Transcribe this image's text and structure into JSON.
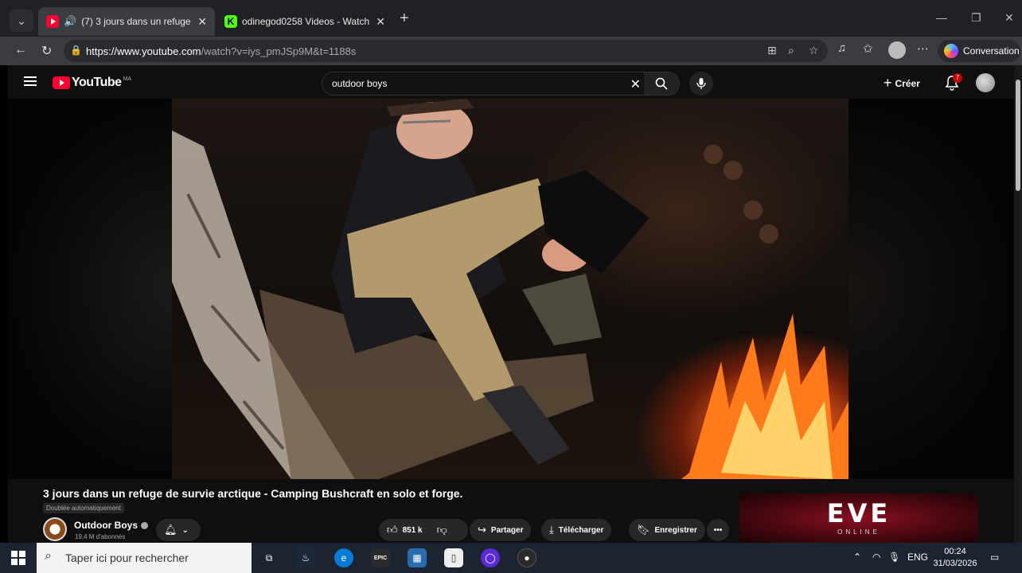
{
  "browser": {
    "tabs": [
      {
        "label": "(7) 3 jours dans un refuge de"
      },
      {
        "label": "odinegod0258 Videos - Watch On"
      }
    ],
    "url_host": "https://www.youtube.com",
    "url_path": "/watch?v=iys_pmJSp9M&t=1188s",
    "conversation_label": "Conversation"
  },
  "youtube": {
    "logo_text": "YouTube",
    "country_code": "MA",
    "search_value": "outdoor boys",
    "create_label": "Créer",
    "notification_count": "7",
    "video_title": "3 jours dans un refuge de survie arctique - Camping Bushcraft en solo et forge.",
    "dub_badge": "Doublée automatiquement",
    "channel_name": "Outdoor Boys",
    "channel_subs": "19,4 M d'abonnés",
    "like_count": "851 k",
    "share_label": "Partager",
    "download_label": "Télécharger",
    "save_label": "Enregistrer",
    "ad_title": "EVE",
    "ad_subtitle": "ONLINE"
  },
  "taskbar": {
    "search_placeholder": "Taper ici pour rechercher",
    "language": "ENG",
    "time": "00:24",
    "date": "31/03/2026"
  },
  "colors": {
    "yt_red": "#ff0033",
    "kick_green": "#53fc18",
    "page_bg": "#0f0f0f",
    "taskbar_bg": "#1c2331"
  }
}
